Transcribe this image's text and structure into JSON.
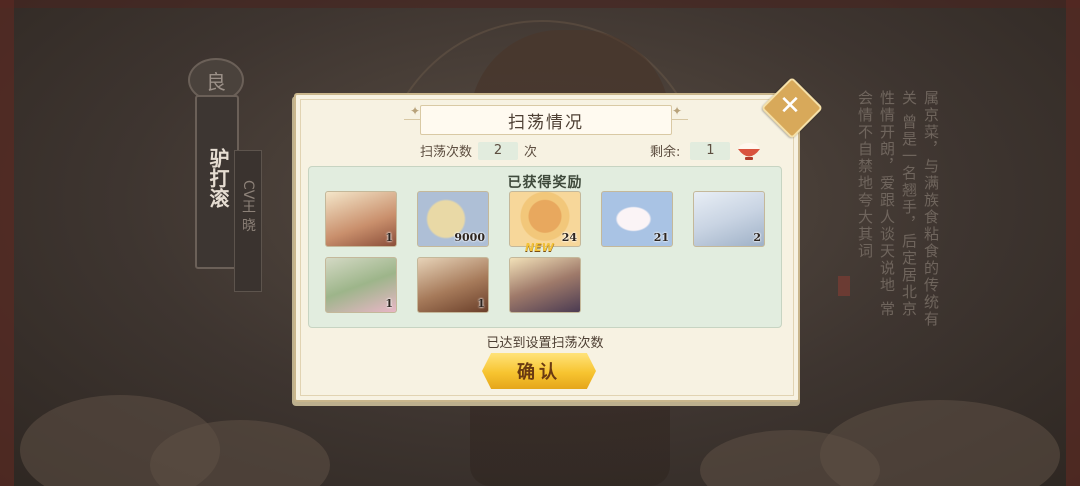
{
  "character": {
    "rank_char": "良",
    "name": "驴打滚",
    "cv_label": "CV王 晓",
    "bio": "属京菜，与满族食粘食的传统有关 曾是一名翘手，后定居北京 性情开朗，爱跟人谈天说地 常会情不自禁地夸大其词"
  },
  "modal": {
    "title": "扫荡情况",
    "sweep_count_label": "扫荡次数",
    "sweep_count_value": "2",
    "sweep_count_unit": "次",
    "remaining_label": "剩余:",
    "remaining_value": "1",
    "rewards_title": "已获得奖励",
    "done_text": "已达到设置扫荡次数",
    "confirm_label": "确认",
    "new_badge": "NEW"
  },
  "rewards": [
    {
      "name": "character-card-1",
      "count": "1"
    },
    {
      "name": "dumpling",
      "count": "9000"
    },
    {
      "name": "coin",
      "count": "24"
    },
    {
      "name": "rabbit-cake",
      "count": "21"
    },
    {
      "name": "character-card-2",
      "count": "2"
    },
    {
      "name": "character-card-3",
      "count": "1"
    },
    {
      "name": "character-card-4",
      "count": "1"
    },
    {
      "name": "character-card-5",
      "count": ""
    }
  ],
  "colors": {
    "accent_gold": "#f7c430",
    "panel_green": "#e2eddf",
    "modal_cream": "#f7f2e2"
  }
}
